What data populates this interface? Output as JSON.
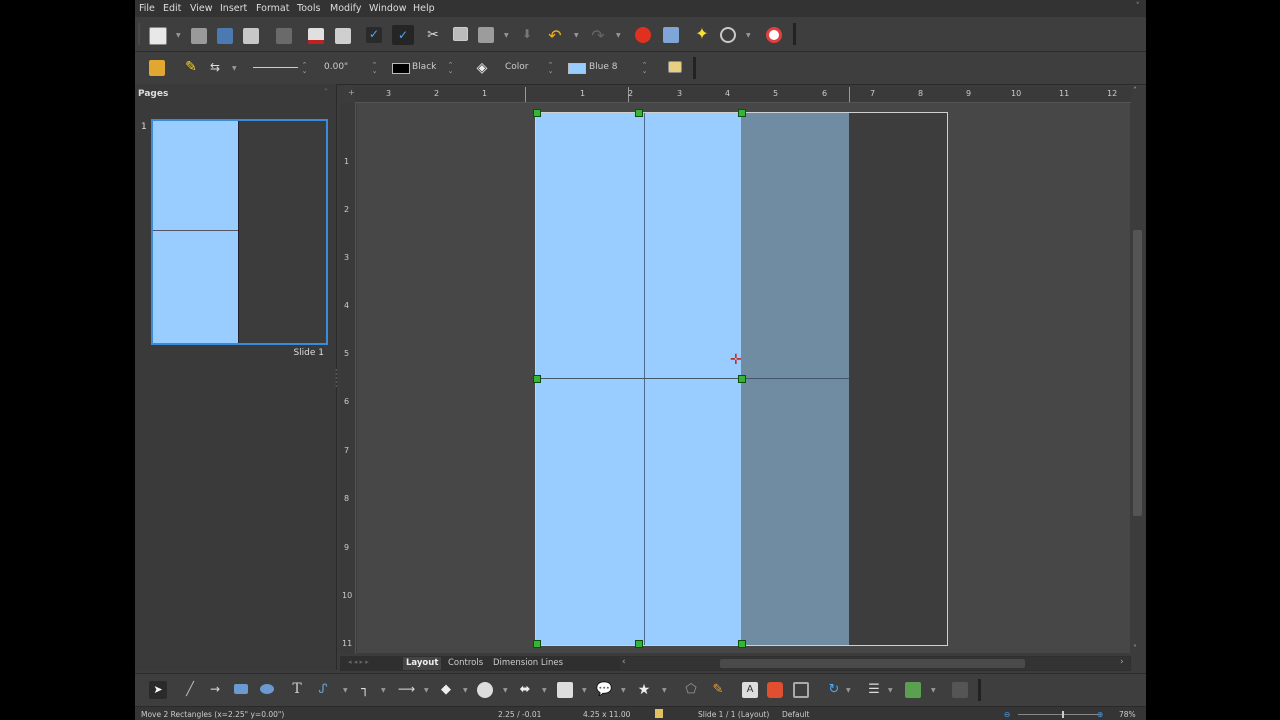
{
  "menu": {
    "items": [
      "File",
      "Edit",
      "View",
      "Insert",
      "Format",
      "Tools",
      "Modify",
      "Window",
      "Help"
    ],
    "close_glyph": "˅"
  },
  "toolbar_standard": {
    "icons": [
      "new-document-icon",
      "open-icon",
      "save-icon",
      "email-icon",
      "edit-file-icon",
      "export-pdf-icon",
      "print-icon",
      "spellcheck-icon",
      "autospellcheck-icon",
      "cut-icon",
      "copy-icon",
      "paste-icon",
      "clone-formatting-icon",
      "undo-icon",
      "redo-icon",
      "chart-icon",
      "image-icon",
      "star-effects-icon",
      "zoom-icon",
      "help-icon"
    ]
  },
  "toolbar_line_fill": {
    "line_width": "0.00\"",
    "line_color_name": "Black",
    "line_color": "#000000",
    "area_style": "Color",
    "fill_color_name": "Blue 8",
    "fill_color": "#99ccff"
  },
  "pages_panel": {
    "title": "Pages",
    "slide_number": "1",
    "slide_caption": "Slide 1"
  },
  "ruler": {
    "horizontal": [
      "3",
      "2",
      "1",
      "1",
      "2",
      "3",
      "4",
      "5",
      "6",
      "7",
      "8",
      "9",
      "10",
      "11",
      "12"
    ],
    "vertical": [
      "1",
      "2",
      "3",
      "4",
      "5",
      "6",
      "7",
      "8",
      "9",
      "10",
      "11"
    ]
  },
  "tabs": [
    "Layout",
    "Controls",
    "Dimension Lines"
  ],
  "status": {
    "action": "Move 2 Rectangles (x=2.25\" y=0.00\")",
    "position": "2.25 / -0.01",
    "size": "4.25 x 11.00",
    "slide": "Slide 1 / 1 (Layout)",
    "master": "Default",
    "zoom": "78%",
    "zoom_fraction": 0.55
  },
  "colors": {
    "fill_light": "#99ccff",
    "fill_dark": "#708ca3",
    "selection_handle": "#35b535",
    "thumbnail_border": "#3d8bd8"
  }
}
